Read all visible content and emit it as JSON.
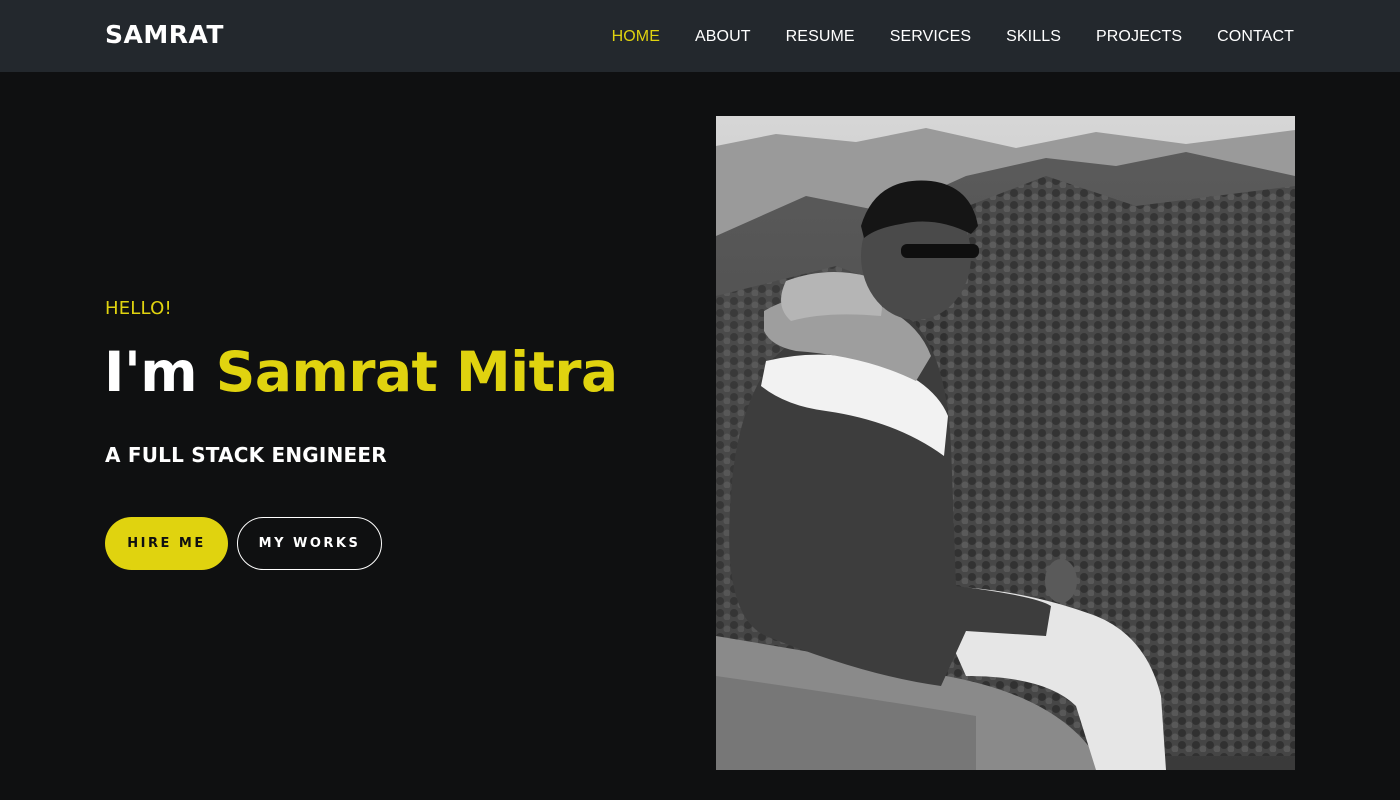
{
  "navbar": {
    "brand": "SAMRAT",
    "links": [
      {
        "label": "HOME",
        "active": true
      },
      {
        "label": "ABOUT",
        "active": false
      },
      {
        "label": "RESUME",
        "active": false
      },
      {
        "label": "SERVICES",
        "active": false
      },
      {
        "label": "SKILLS",
        "active": false
      },
      {
        "label": "PROJECTS",
        "active": false
      },
      {
        "label": "CONTACT",
        "active": false
      }
    ]
  },
  "hero": {
    "greeting": "HELLO!",
    "intro": "I'm",
    "name": "Samrat Mitra",
    "role": "A FULL STACK ENGINEER",
    "primary_button": "HIRE ME",
    "secondary_button": "MY WORKS"
  },
  "colors": {
    "accent": "#e0d30f",
    "navbar_bg": "#23282d",
    "page_bg": "#0f1011",
    "text": "#ffffff"
  }
}
